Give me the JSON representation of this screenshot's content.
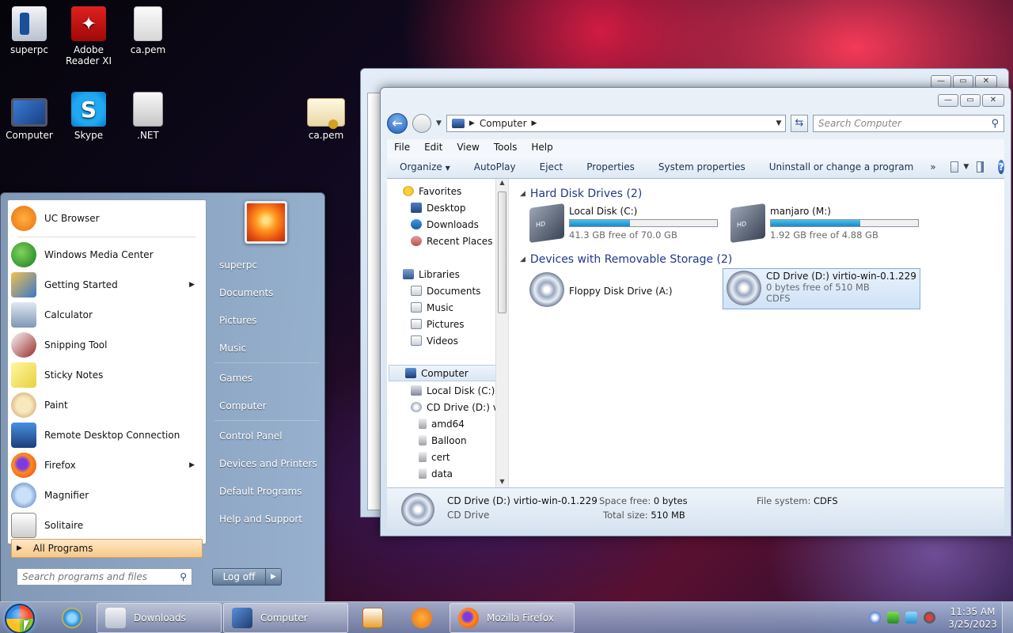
{
  "desktop": {
    "icons": [
      {
        "label": "superpc",
        "icon": "user-folder-icon"
      },
      {
        "label": "Adobe Reader XI",
        "icon": "adobe-reader-icon"
      },
      {
        "label": "ca.pem",
        "icon": "file-icon"
      },
      {
        "label": "Computer",
        "icon": "computer-icon"
      },
      {
        "label": "Skype",
        "icon": "skype-icon"
      },
      {
        "label": ".NET",
        "icon": "folder-icon"
      },
      {
        "label": "ca.pem",
        "icon": "certificate-icon"
      }
    ]
  },
  "explorer": {
    "address": {
      "location": "Computer"
    },
    "search": {
      "placeholder": "Search Computer"
    },
    "menu": [
      "File",
      "Edit",
      "View",
      "Tools",
      "Help"
    ],
    "toolbar": [
      "Organize",
      "AutoPlay",
      "Eject",
      "Properties",
      "System properties",
      "Uninstall or change a program",
      "»"
    ],
    "nav": {
      "favorites": "Favorites",
      "desktop": "Desktop",
      "downloads": "Downloads",
      "recent": "Recent Places",
      "libraries": "Libraries",
      "documents": "Documents",
      "music": "Music",
      "pictures": "Pictures",
      "videos": "Videos",
      "computer": "Computer",
      "local_disk": "Local Disk (C:)",
      "cd_drive": "CD Drive (D:) virt",
      "amd64": "amd64",
      "balloon": "Balloon",
      "cert": "cert",
      "data": "data"
    },
    "groups": {
      "hdd": "Hard Disk Drives (2)",
      "removable": "Devices with Removable Storage (2)"
    },
    "drives": {
      "c": {
        "name": "Local Disk (C:)",
        "free": "41.3 GB free of 70.0 GB",
        "used_fraction": 0.41
      },
      "m": {
        "name": "manjaro (M:)",
        "free": "1.92 GB free of 4.88 GB",
        "used_fraction": 0.61
      },
      "a": {
        "name": "Floppy Disk Drive (A:)"
      },
      "d": {
        "name": "CD Drive (D:) virtio-win-0.1.229",
        "free": "0 bytes free of 510 MB",
        "fs": "CDFS"
      }
    },
    "details": {
      "name": "CD Drive (D:) virtio-win-0.1.229",
      "type": "CD Drive",
      "space_free_label": "Space free:",
      "space_free": "0 bytes",
      "total_size_label": "Total size:",
      "total_size": "510 MB",
      "fs_label": "File system:",
      "fs": "CDFS"
    }
  },
  "start_menu": {
    "programs": [
      {
        "label": "UC Browser",
        "submenu": false
      },
      {
        "label": "Windows Media Center",
        "submenu": false
      },
      {
        "label": "Getting Started",
        "submenu": true
      },
      {
        "label": "Calculator",
        "submenu": false
      },
      {
        "label": "Snipping Tool",
        "submenu": false
      },
      {
        "label": "Sticky Notes",
        "submenu": false
      },
      {
        "label": "Paint",
        "submenu": false
      },
      {
        "label": "Remote Desktop Connection",
        "submenu": false
      },
      {
        "label": "Firefox",
        "submenu": true
      },
      {
        "label": "Magnifier",
        "submenu": false
      },
      {
        "label": "Solitaire",
        "submenu": false
      }
    ],
    "all_programs": "All Programs",
    "search_placeholder": "Search programs and files",
    "right_links": [
      "superpc",
      "Documents",
      "Pictures",
      "Music",
      "Games",
      "Computer",
      "Control Panel",
      "Devices and Printers",
      "Default Programs",
      "Help and Support"
    ],
    "logoff": "Log off"
  },
  "taskbar": {
    "buttons": [
      {
        "label": "Downloads"
      },
      {
        "label": "Computer"
      },
      {
        "label": "Mozilla Firefox"
      }
    ],
    "clock": {
      "time": "11:35 AM",
      "date": "3/25/2023"
    }
  }
}
